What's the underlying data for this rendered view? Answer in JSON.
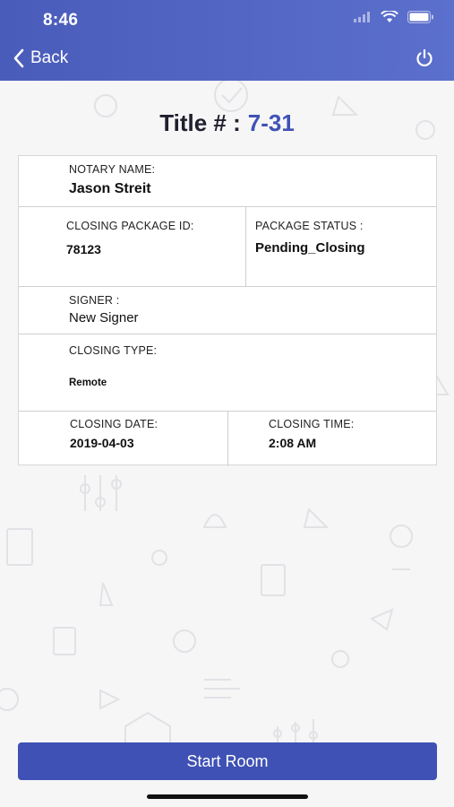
{
  "status_bar": {
    "time": "8:46"
  },
  "nav": {
    "back_label": "Back"
  },
  "title": {
    "label": "Title # :",
    "value": "7-31"
  },
  "details": {
    "notary_name": {
      "label": "NOTARY NAME:",
      "value": "Jason Streit"
    },
    "closing_package_id": {
      "label": "CLOSING PACKAGE ID:",
      "value": "78123"
    },
    "package_status": {
      "label": "PACKAGE STATUS :",
      "value": "Pending_Closing"
    },
    "signer": {
      "label": "SIGNER :",
      "value": "New Signer"
    },
    "closing_type": {
      "label": "CLOSING TYPE:",
      "value": "Remote"
    },
    "closing_date": {
      "label": "CLOSING DATE:",
      "value": "2019-04-03"
    },
    "closing_time": {
      "label": "CLOSING TIME:",
      "value": "2:08 AM"
    }
  },
  "actions": {
    "start_room_label": "Start Room"
  },
  "colors": {
    "header": "#4a5cba",
    "accent": "#3f51b5",
    "title_value": "#3f52b5"
  },
  "icons": [
    "wifi-icon",
    "signal-icon",
    "battery-icon",
    "chevron-left-icon",
    "power-icon"
  ]
}
